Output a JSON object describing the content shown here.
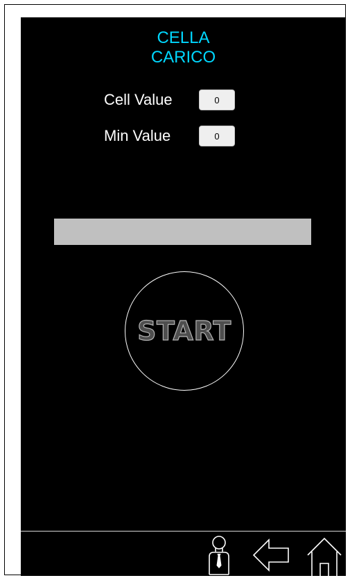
{
  "header": {
    "title_line1": "CELLA",
    "title_line2": "CARICO"
  },
  "fields": {
    "cell_value": {
      "label": "Cell Value",
      "value": "0"
    },
    "min_value": {
      "label": "Min Value",
      "value": "0"
    }
  },
  "progress": {
    "fraction": 0,
    "track_color": "#c0c0c0"
  },
  "start_button": {
    "label": "START"
  },
  "footer": {
    "icons": [
      "user-icon",
      "back-arrow-icon",
      "home-icon"
    ]
  },
  "colors": {
    "background": "#000000",
    "title": "#00d7ff",
    "label": "#ffffff"
  }
}
